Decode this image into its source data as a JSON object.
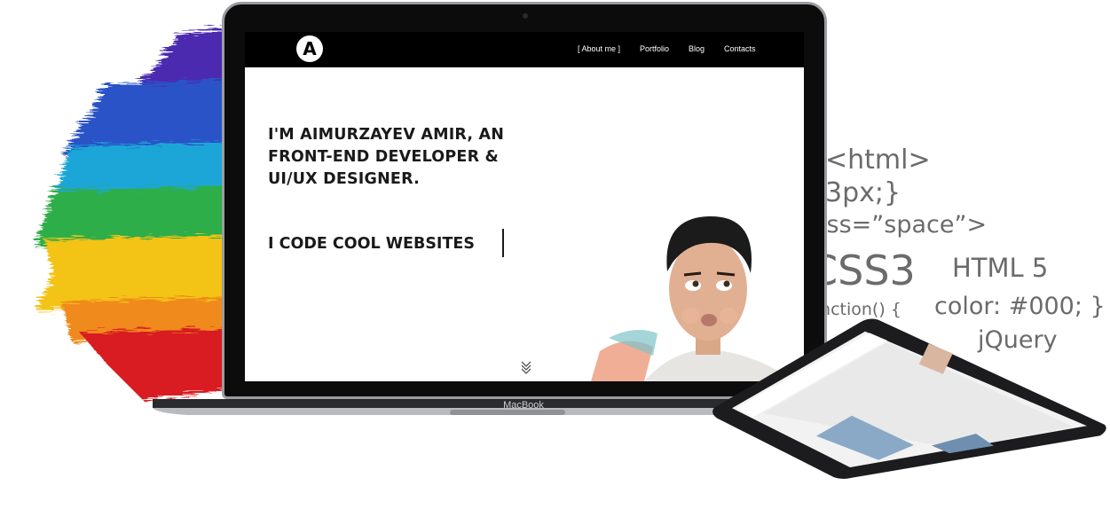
{
  "nav": {
    "links": [
      "[ About me ]",
      "Portfolio",
      "Blog",
      "Contacts"
    ]
  },
  "logo": {
    "letter": "A"
  },
  "hero": {
    "headline_lines": [
      "I'M AIMURZAYEV AMIR, AN",
      "FRONT-END DEVELOPER &",
      "UI/UX DESIGNER."
    ],
    "tagline": "I CODE COOL WEBSITES"
  },
  "device": {
    "brand": "MacBook"
  },
  "code_snippets": {
    "html_tag": "<html>",
    "px_rule": "3px;}",
    "class_attr": "ass=”space”>",
    "css3": "CSS3",
    "html5": "HTML 5",
    "function": "unction() {",
    "color_rule": "color: #000; }",
    "jquery": "jQuery"
  },
  "icons": {
    "scroll": "double-chevron-down-icon",
    "logo": "a-letter-logo-icon"
  },
  "colors": {
    "nav_bg": "#000000",
    "headline": "#1a1a1a",
    "code_text": "#6b6b6b",
    "laptop_frame": "#9a9ca0"
  }
}
